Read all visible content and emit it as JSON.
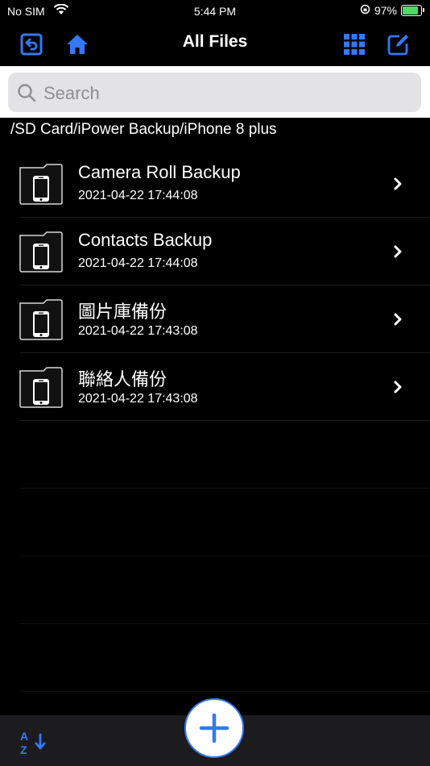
{
  "status_bar": {
    "carrier": "No SIM",
    "time": "5:44 PM",
    "battery": "97%"
  },
  "nav": {
    "title": "All Files",
    "left_icons": [
      "back-icon",
      "home-icon"
    ],
    "right_icons": [
      "grid-view-icon",
      "edit-icon"
    ]
  },
  "search": {
    "placeholder": "Search"
  },
  "path": "/SD Card/iPower Backup/iPhone 8 plus",
  "files": [
    {
      "name": "Camera Roll Backup",
      "date": "2021-04-22 17:44:08"
    },
    {
      "name": "Contacts Backup",
      "date": "2021-04-22 17:44:08"
    },
    {
      "name": "圖片庫備份",
      "date": "2021-04-22 17:43:08"
    },
    {
      "name": "聯絡人備份",
      "date": "2021-04-22 17:43:08"
    }
  ],
  "toolbar": {
    "sort_icon": "sort-az-icon",
    "add_icon": "plus-icon"
  },
  "colors": {
    "accent": "#3478f6",
    "background": "#000000",
    "toolbar": "#1c1c1e",
    "battery_fill": "#4cd964"
  }
}
